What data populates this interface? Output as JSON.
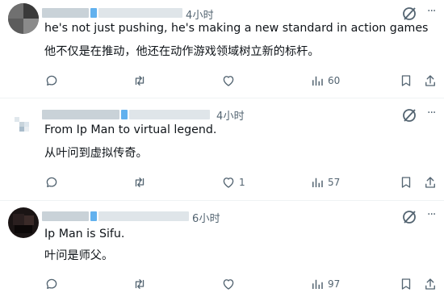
{
  "replies": [
    {
      "timestamp": "4小时",
      "text_en": "he's not just pushing, he's making a new standard in action games",
      "text_zh": "他不仅是在推动，他还在动作游戏领域树立新的标杆。",
      "likes": "",
      "views": "60"
    },
    {
      "timestamp": "4小时",
      "text_en": "From Ip Man to virtual legend.",
      "text_zh": "从叶问到虚拟传奇。",
      "likes": "1",
      "views": "57"
    },
    {
      "timestamp": "6小时",
      "text_en": "Ip Man is Sifu.",
      "text_zh": "叶问是师父。",
      "likes": "",
      "views": "97"
    }
  ],
  "icons": {
    "reply": "speech-bubble-icon",
    "retweet": "retweet-icon",
    "like": "heart-icon",
    "views": "bar-chart-icon",
    "bookmark": "bookmark-icon",
    "share": "share-icon",
    "grok": "grok-icon",
    "more": "more-icon"
  },
  "colors": {
    "text": "#0f1419",
    "secondary": "#536471",
    "divider": "#eff3f4",
    "accent": "#1d9bf0"
  }
}
